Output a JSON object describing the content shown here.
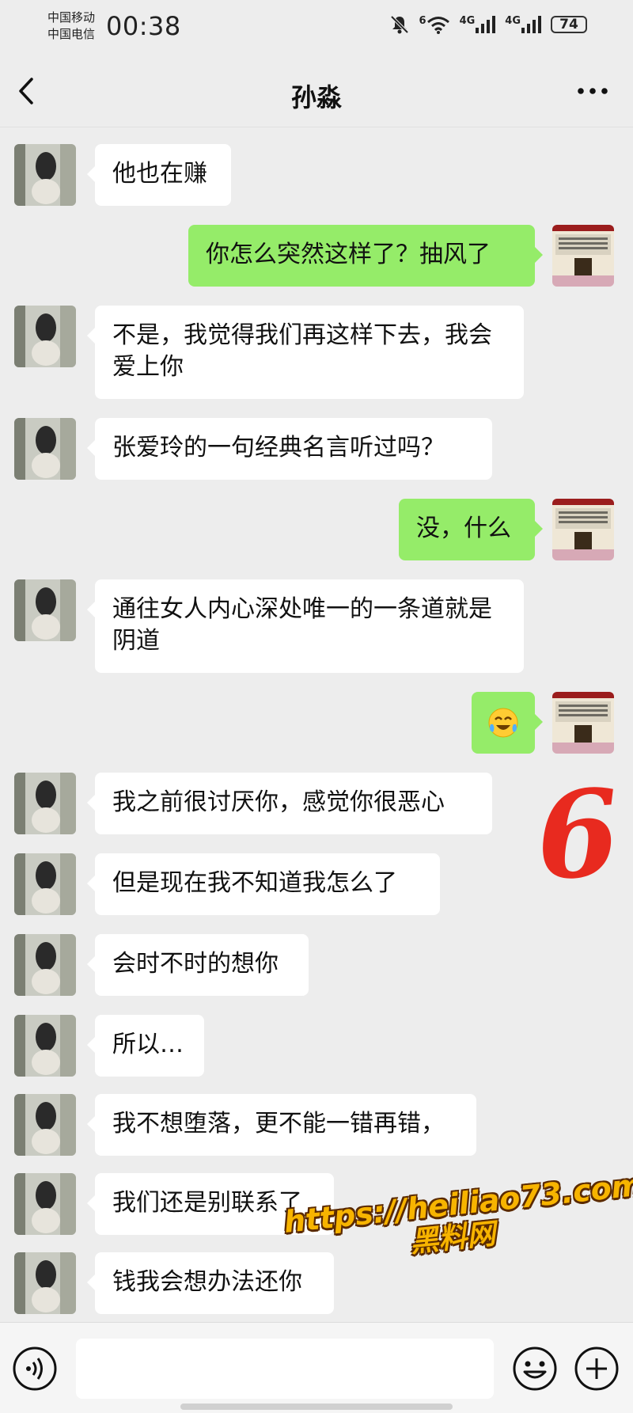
{
  "status_bar": {
    "carrier_1": "中国移动",
    "carrier_2": "中国电信",
    "time": "00:38",
    "signal_1_label": "4G",
    "signal_2_label": "4G",
    "wifi_label": "6",
    "battery": "74"
  },
  "header": {
    "title": "孙淼"
  },
  "messages": [
    {
      "side": "in",
      "text": "他也在赚"
    },
    {
      "side": "out",
      "text": "你怎么突然这样了？抽风了"
    },
    {
      "side": "in",
      "text": "不是，我觉得我们再这样下去，我会爱上你"
    },
    {
      "side": "in",
      "text": "张爱玲的一句经典名言听过吗？"
    },
    {
      "side": "out",
      "text": "没，什么"
    },
    {
      "side": "in",
      "text": "通往女人内心深处唯一的一条道就是阴道"
    },
    {
      "side": "out",
      "text": "",
      "emoji": "laughing-crying-emoji"
    },
    {
      "side": "in",
      "text": "我之前很讨厌你，感觉你很恶心"
    },
    {
      "side": "in",
      "text": "但是现在我不知道我怎么了"
    },
    {
      "side": "in",
      "text": "会时不时的想你"
    },
    {
      "side": "in",
      "text": "所以…"
    },
    {
      "side": "in",
      "text": "我不想堕落，更不能一错再错，"
    },
    {
      "side": "in",
      "text": "我们还是别联系了"
    },
    {
      "side": "in",
      "text": "钱我会想办法还你"
    }
  ],
  "annotation": {
    "text": "6",
    "color": "#e82a1f"
  },
  "watermark": {
    "url": "https://heiliao73.com",
    "name": "黑料网"
  },
  "colors": {
    "background": "#ededed",
    "outgoing_bubble": "#95ec69",
    "incoming_bubble": "#ffffff"
  }
}
